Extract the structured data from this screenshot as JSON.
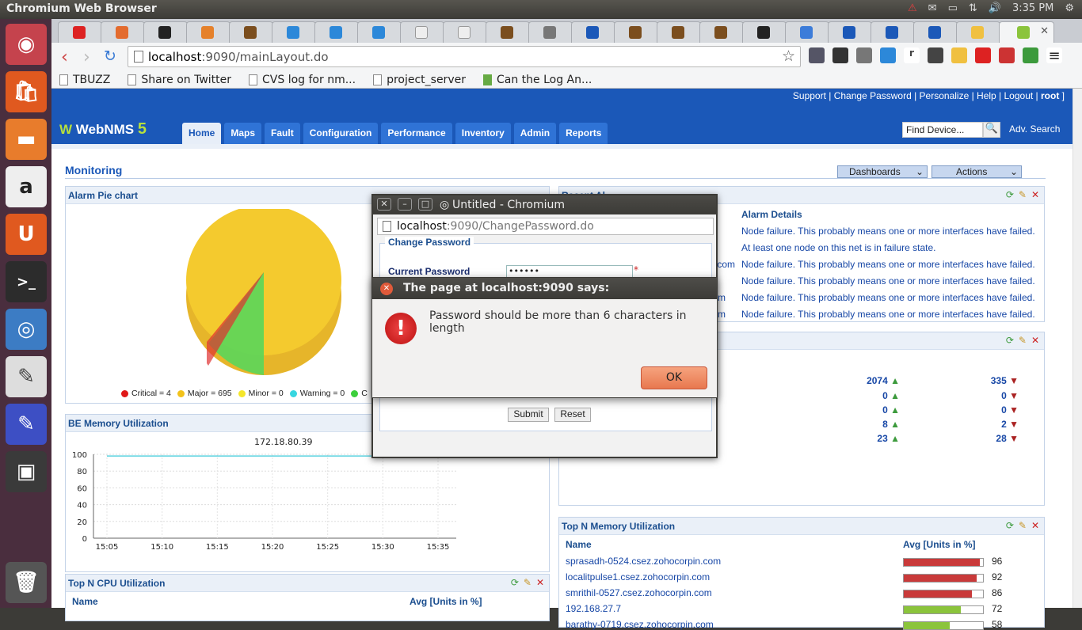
{
  "os": {
    "window_title": "Chromium Web Browser",
    "clock": "3:35 PM"
  },
  "browser": {
    "url_host": "localhost",
    "url_rest": ":9090/mainLayout.do",
    "bookmarks": [
      "TBUZZ",
      "Share on Twitter",
      "CVS log for nm...",
      "project_server",
      "Can the Log An..."
    ]
  },
  "app": {
    "logo_name": "WebNMS",
    "logo_version": "5",
    "top_links": "Support | Change Password | Personalize | Help | Logout | ",
    "user": "root",
    "tabs": [
      "Home",
      "Maps",
      "Fault",
      "Configuration",
      "Performance",
      "Inventory",
      "Admin",
      "Reports"
    ],
    "find_placeholder": "Find Device...",
    "adv_search": "Adv. Search",
    "section_title": "Monitoring",
    "dashboards_label": "Dashboards",
    "actions_label": "Actions"
  },
  "alarm_pie": {
    "title": "Alarm Pie chart",
    "legend": [
      {
        "label": "Critical = 4",
        "color": "#e01818"
      },
      {
        "label": "Major = 695",
        "color": "#f2c21b"
      },
      {
        "label": "Minor = 0",
        "color": "#f5e62a"
      },
      {
        "label": "Warning = 0",
        "color": "#37d6e0"
      },
      {
        "label": "C",
        "color": "#3ccf3c"
      }
    ]
  },
  "recent_alarms": {
    "title": "Recent Al",
    "header": "Alarm Details",
    "rows": [
      "Node failure. This probably means one or more interfaces have failed.",
      "At least one node on this net is in failure state.",
      "Node failure. This probably means one or more interfaces have failed.",
      "Node failure. This probably means one or more interfaces have failed.",
      "Node failure. This probably means one or more interfaces have failed.",
      "Node failure. This probably means one or more interfaces have failed."
    ],
    "partial_names": [
      ".com",
      "m",
      "m"
    ]
  },
  "counts_panel": {
    "rows": [
      {
        "a": "2074",
        "b": "335"
      },
      {
        "a": "0",
        "b": "0"
      },
      {
        "a": "0",
        "b": "0"
      },
      {
        "a": "8",
        "b": "2"
      },
      {
        "a": "23",
        "b": "28"
      }
    ]
  },
  "be_memory": {
    "title": "BE Memory Utilization"
  },
  "chart_data": {
    "type": "line",
    "title": "172.18.80.39",
    "x": [
      "15:05",
      "15:10",
      "15:15",
      "15:20",
      "15:25",
      "15:30",
      "15:35"
    ],
    "series": [
      {
        "values": [
          98,
          98,
          98,
          98,
          98,
          98,
          98
        ]
      }
    ],
    "ylim": [
      0,
      100
    ],
    "yticks": [
      0,
      20,
      40,
      60,
      80,
      100
    ]
  },
  "top_cpu": {
    "title": "Top N CPU Utilization",
    "col_name": "Name",
    "col_avg": "Avg [Units in %]"
  },
  "top_memory": {
    "title": "Top N Memory Utilization",
    "col_name": "Name",
    "col_avg": "Avg [Units in %]",
    "rows": [
      {
        "name": "sprasadh-0524.csez.zohocorpin.com",
        "value": 96,
        "color": "#c93a3a"
      },
      {
        "name": "localitpulse1.csez.zohocorpin.com",
        "value": 92,
        "color": "#c93a3a"
      },
      {
        "name": "smrithil-0527.csez.zohocorpin.com",
        "value": 86,
        "color": "#c93a3a"
      },
      {
        "name": "192.168.27.7",
        "value": 72,
        "color": "#8bc43c"
      },
      {
        "name": "barathy-0719.csez.zohocorpin.com",
        "value": 58,
        "color": "#8bc43c"
      }
    ]
  },
  "popup": {
    "title": "Untitled - Chromium",
    "url_host": "localhost",
    "url_rest": ":9090/ChangePassword.do",
    "legend": "Change Password",
    "current_label": "Current Password",
    "current_value": "••••••",
    "submit": "Submit",
    "reset": "Reset"
  },
  "alert": {
    "title": "The page at localhost:9090 says:",
    "message": "Password should be more than 6 characters in length",
    "ok": "OK"
  }
}
